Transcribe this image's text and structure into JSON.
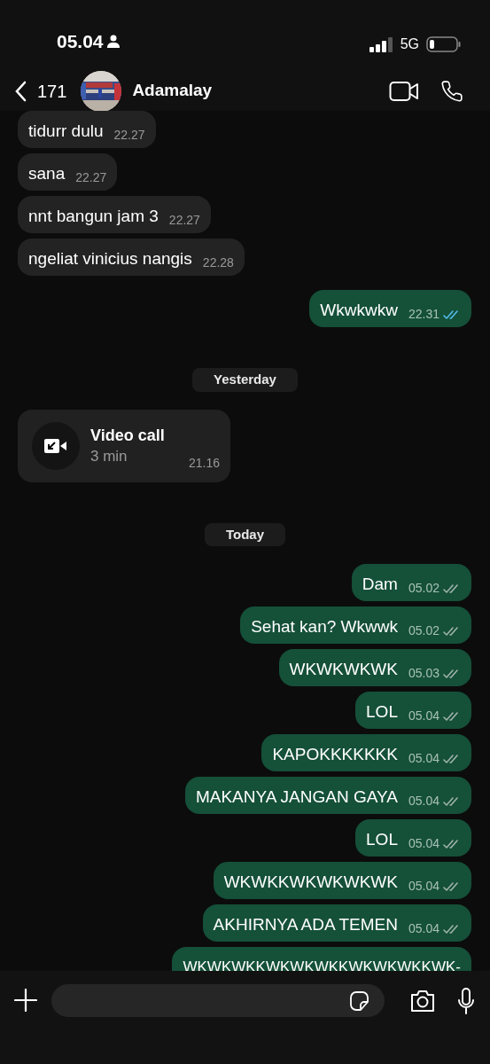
{
  "status_bar": {
    "time": "05.04",
    "network": "5G"
  },
  "header": {
    "back_count": "171",
    "name": "Adamalay"
  },
  "messages": [
    {
      "kind": "text",
      "outgoing": false,
      "text": "tidurr dulu",
      "time": "22.27"
    },
    {
      "kind": "text",
      "outgoing": false,
      "text": "sana",
      "time": "22.27"
    },
    {
      "kind": "text",
      "outgoing": false,
      "text": "nnt bangun jam 3",
      "time": "22.27"
    },
    {
      "kind": "text",
      "outgoing": false,
      "text": "ngeliat vinicius nangis",
      "time": "22.28"
    },
    {
      "kind": "text",
      "outgoing": true,
      "text": "Wkwkwkw",
      "time": "22.31",
      "read": true
    },
    {
      "kind": "date",
      "text": "Yesterday"
    },
    {
      "kind": "call",
      "title": "Video call",
      "duration": "3 min",
      "time": "21.16"
    },
    {
      "kind": "date",
      "text": "Today"
    },
    {
      "kind": "text",
      "outgoing": true,
      "text": "Dam",
      "time": "05.02",
      "read": false
    },
    {
      "kind": "text",
      "outgoing": true,
      "text": "Sehat kan? Wkwwk",
      "time": "05.02",
      "read": false
    },
    {
      "kind": "text",
      "outgoing": true,
      "text": "WKWKWKWK",
      "time": "05.03",
      "read": false
    },
    {
      "kind": "text",
      "outgoing": true,
      "text": "LOL",
      "time": "05.04",
      "read": false
    },
    {
      "kind": "text",
      "outgoing": true,
      "text": "KAPOKKKKKKK",
      "time": "05.04",
      "read": false
    },
    {
      "kind": "text",
      "outgoing": true,
      "text": "MAKANYA JANGAN GAYA",
      "time": "05.04",
      "read": false
    },
    {
      "kind": "text",
      "outgoing": true,
      "text": "LOL",
      "time": "05.04",
      "read": false
    },
    {
      "kind": "text",
      "outgoing": true,
      "text": "WKWKKWKWKWKWK",
      "time": "05.04",
      "read": false
    },
    {
      "kind": "text",
      "outgoing": true,
      "text": "AKHIRNYA ADA TEMEN",
      "time": "05.04",
      "read": false
    },
    {
      "kind": "cut",
      "outgoing": true,
      "text": "WKWKWKKWKWKWKKWKWKWKKWK-"
    }
  ]
}
